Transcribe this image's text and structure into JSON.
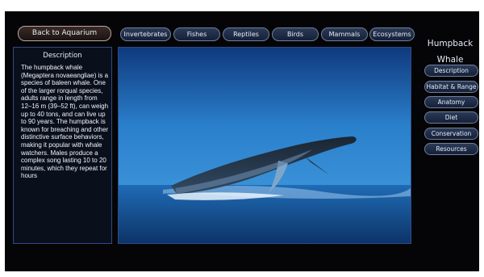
{
  "top": {
    "back_label": "Back to Aquarium"
  },
  "nav": {
    "items": [
      {
        "label": "Invertebrates"
      },
      {
        "label": "Fishes"
      },
      {
        "label": "Reptiles"
      },
      {
        "label": "Birds"
      },
      {
        "label": "Mammals"
      },
      {
        "label": "Ecosystems"
      }
    ]
  },
  "description": {
    "title": "Description",
    "body": "The humpback whale (Megaptera novaeangliae) is a species of baleen whale. One of the larger rorqual species, adults range in length from 12–16 m (39–52 ft), can weigh up to 40 tons, and can live up to 90 years. The humpback is known for breaching and other distinctive surface behaviors, making it popular with whale watchers. Males produce a complex song lasting 10 to 20 minutes, which they repeat for hours"
  },
  "sidebar": {
    "title_line1": "Humpback",
    "title_line2": "Whale",
    "items": [
      {
        "label": "Description"
      },
      {
        "label": "Habitat & Range"
      },
      {
        "label": "Anatomy"
      },
      {
        "label": "Diet"
      },
      {
        "label": "Conservation"
      },
      {
        "label": "Resources"
      }
    ]
  },
  "colors": {
    "panel_border": "#2f4a88",
    "pill_border": "#6f7f9a",
    "sea": "#2a82cf"
  }
}
